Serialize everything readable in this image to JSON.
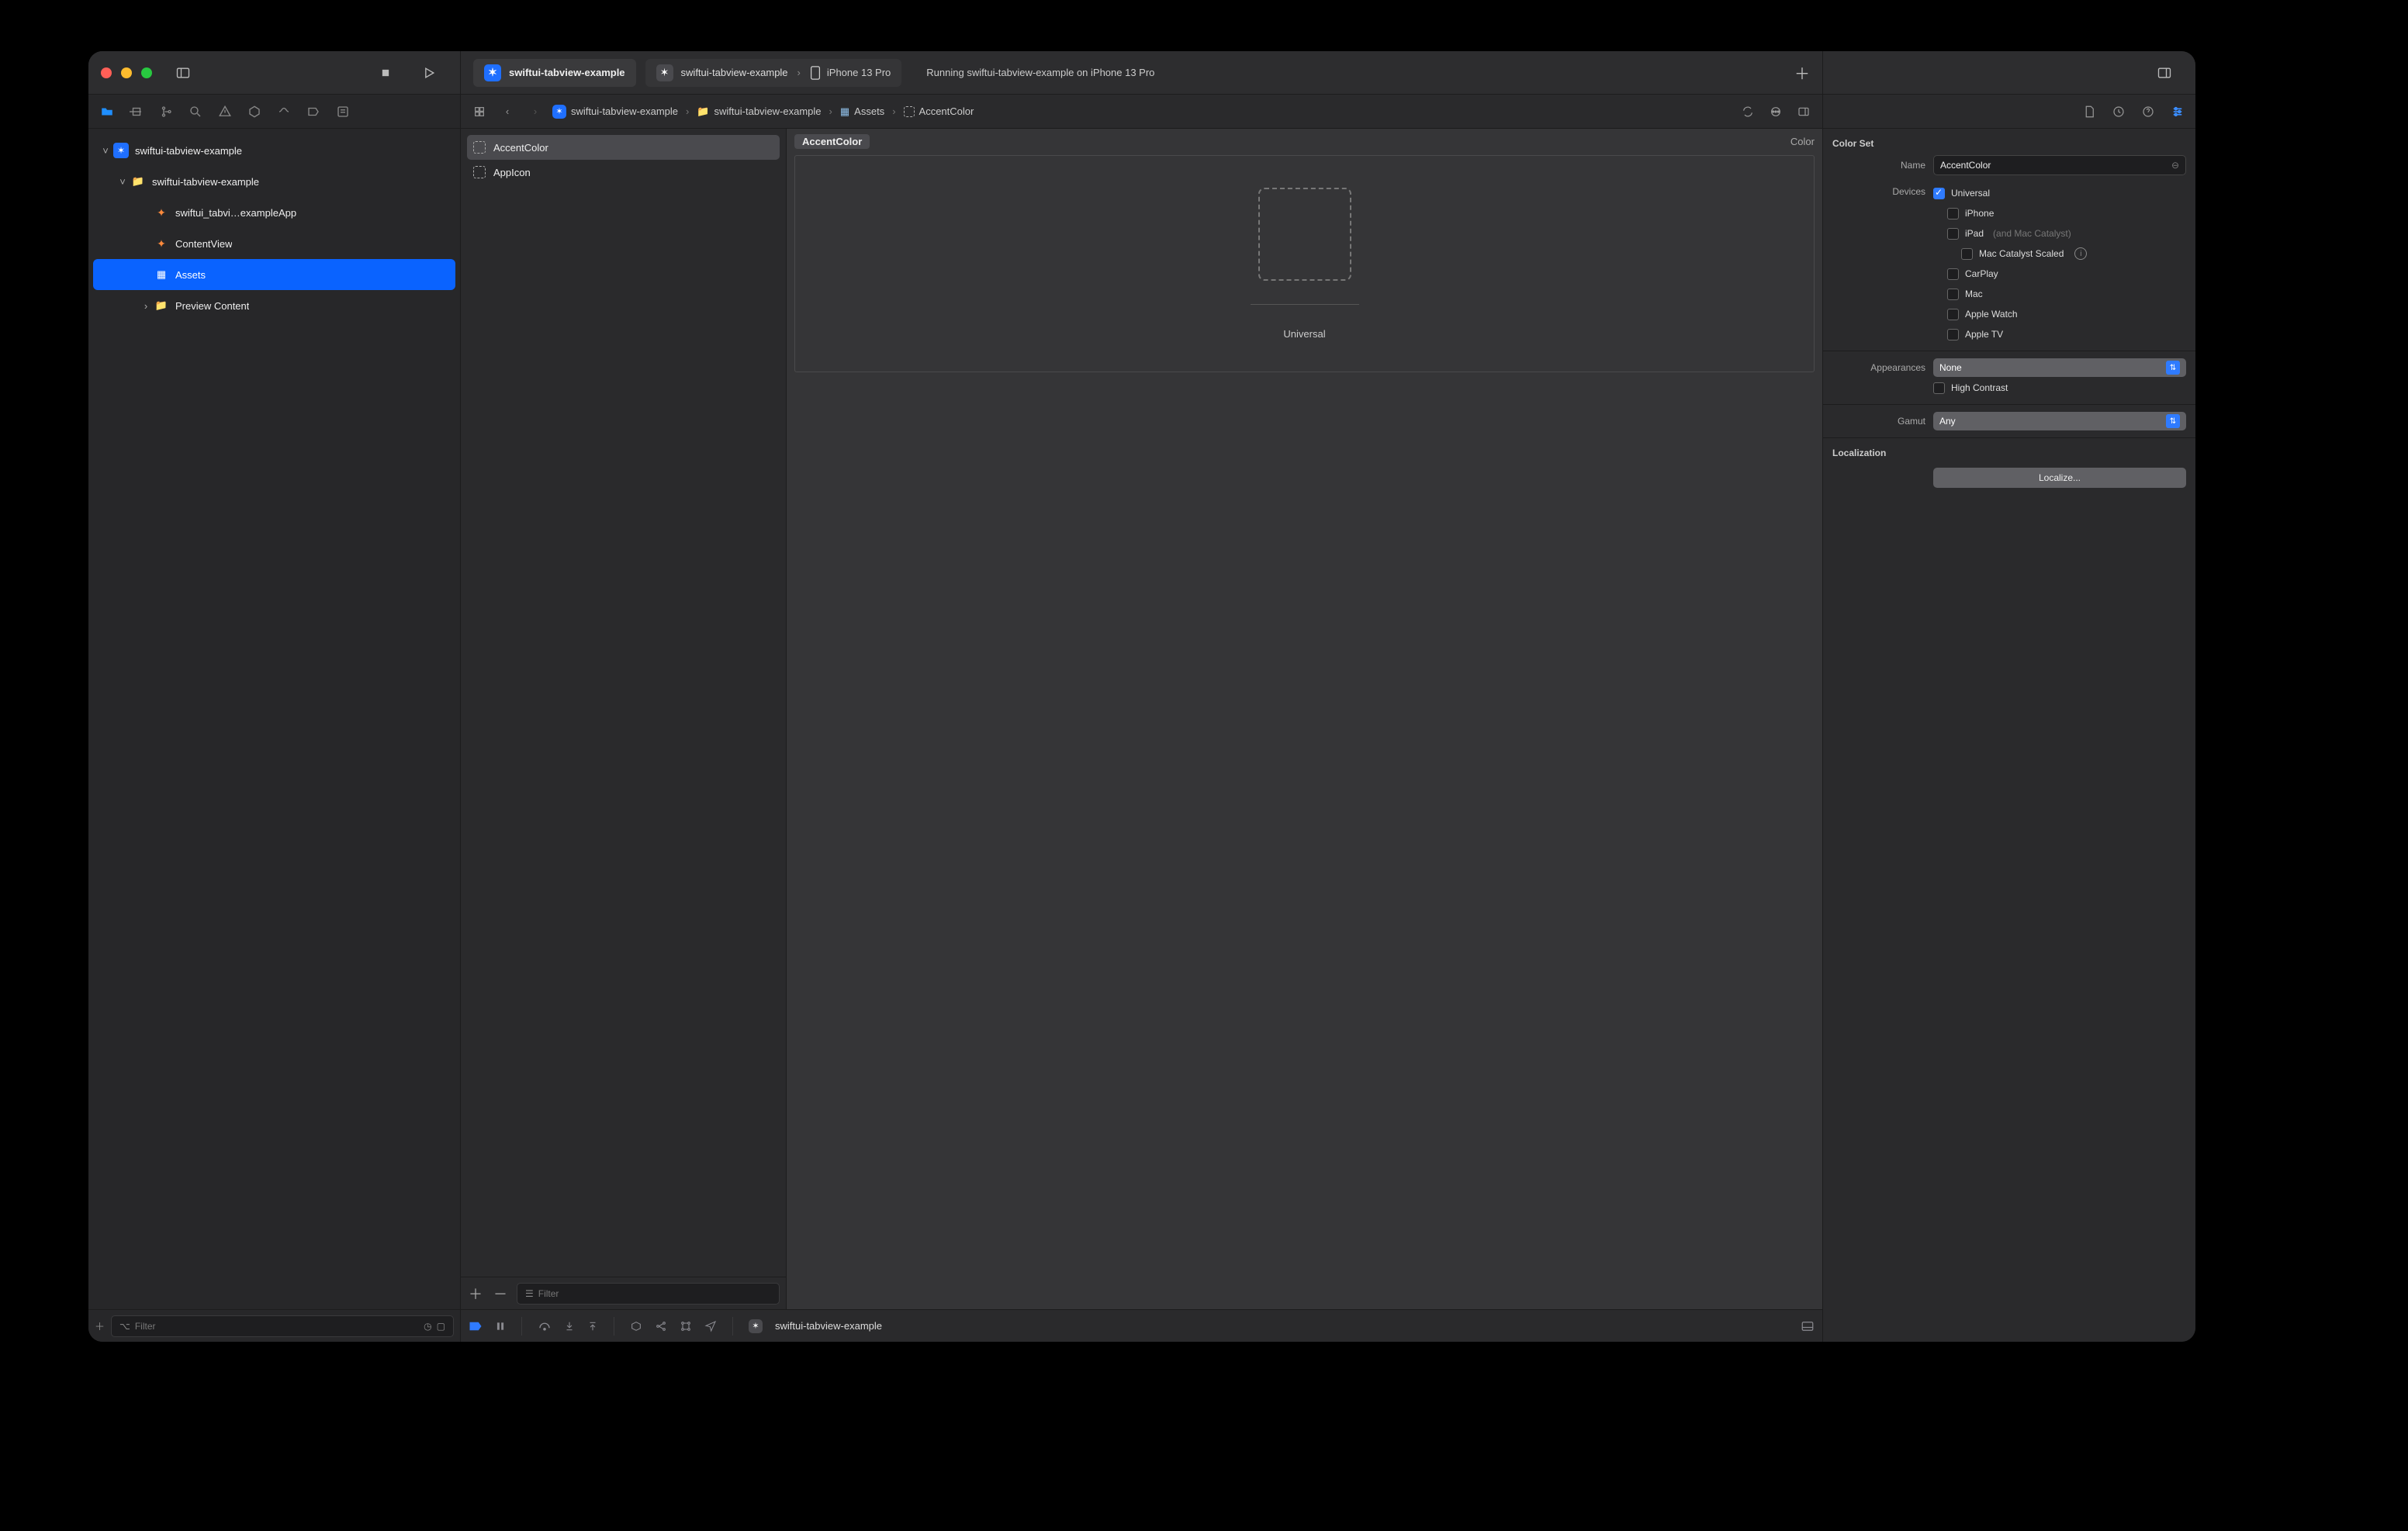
{
  "toolbar": {
    "project_title": "swiftui-tabview-example",
    "scheme": "swiftui-tabview-example",
    "device": "iPhone 13 Pro",
    "status": "Running swiftui-tabview-example on iPhone 13 Pro"
  },
  "navigators": {
    "filter_placeholder": "Filter"
  },
  "project_tree": {
    "root": "swiftui-tabview-example",
    "target": "swiftui-tabview-example",
    "files": {
      "app": "swiftui_tabvi…exampleApp",
      "contentview": "ContentView",
      "assets": "Assets",
      "preview": "Preview Content"
    }
  },
  "breadcrumb": {
    "proj": "swiftui-tabview-example",
    "target": "swiftui-tabview-example",
    "assets": "Assets",
    "item": "AccentColor"
  },
  "asset_list": {
    "items": [
      "AccentColor",
      "AppIcon"
    ],
    "filter_placeholder": "Filter"
  },
  "canvas": {
    "title": "AccentColor",
    "kind": "Color",
    "slot_label": "Universal"
  },
  "debug": {
    "process": "swiftui-tabview-example"
  },
  "inspector": {
    "header": "Color Set",
    "name_label": "Name",
    "name_value": "AccentColor",
    "devices_label": "Devices",
    "devices": {
      "universal": "Universal",
      "iphone": "iPhone",
      "ipad": "iPad",
      "ipad_sub": "(and Mac Catalyst)",
      "mac_catalyst_scaled": "Mac Catalyst Scaled",
      "carplay": "CarPlay",
      "mac": "Mac",
      "watch": "Apple Watch",
      "tv": "Apple TV"
    },
    "appearances_label": "Appearances",
    "appearances_value": "None",
    "high_contrast": "High Contrast",
    "gamut_label": "Gamut",
    "gamut_value": "Any",
    "localization_label": "Localization",
    "localize_button": "Localize..."
  }
}
